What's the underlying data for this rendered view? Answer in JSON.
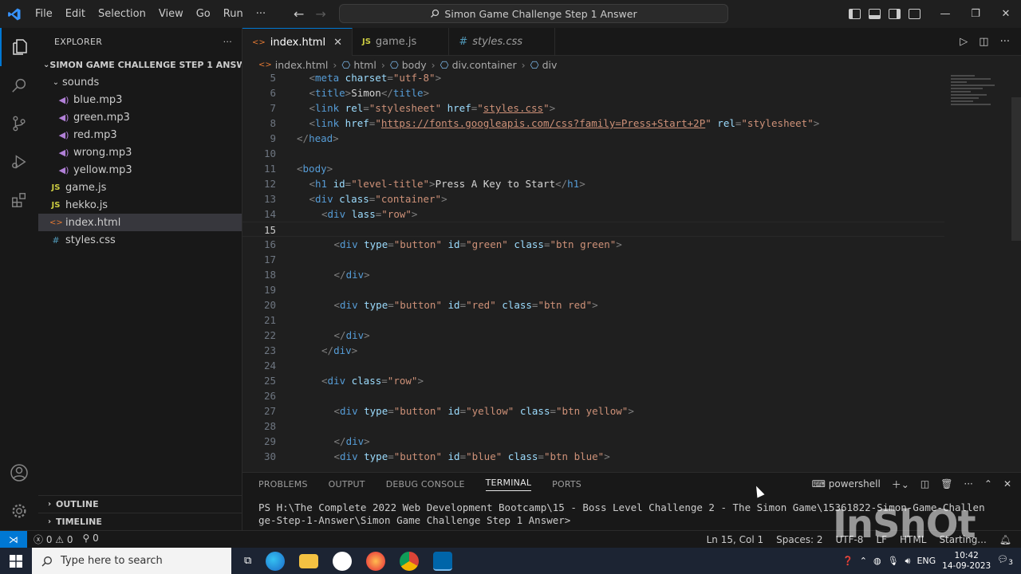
{
  "titlebar": {
    "menu": [
      "File",
      "Edit",
      "Selection",
      "View",
      "Go",
      "Run",
      "···"
    ],
    "command_center": "Simon Game Challenge Step 1 Answer",
    "controls": [
      "—",
      "❐",
      "✕"
    ]
  },
  "explorer": {
    "header": "EXPLORER",
    "more": "···",
    "root": "SIMON GAME CHALLENGE STEP 1 ANSWER",
    "sounds_folder": "sounds",
    "sound_files": [
      "blue.mp3",
      "green.mp3",
      "red.mp3",
      "wrong.mp3",
      "yellow.mp3"
    ],
    "files": [
      {
        "name": "game.js",
        "icon": "JS",
        "type": "js"
      },
      {
        "name": "hekko.js",
        "icon": "JS",
        "type": "js"
      },
      {
        "name": "index.html",
        "icon": "<>",
        "type": "html"
      },
      {
        "name": "styles.css",
        "icon": "#",
        "type": "css"
      }
    ],
    "outline": "OUTLINE",
    "timeline": "TIMELINE"
  },
  "tabs": [
    {
      "label": "index.html",
      "icon": "<>",
      "active": true
    },
    {
      "label": "game.js",
      "icon": "JS",
      "active": false
    },
    {
      "label": "styles.css",
      "icon": "#",
      "active": false
    }
  ],
  "breadcrumb": [
    "index.html",
    "html",
    "body",
    "div.container",
    "div"
  ],
  "code": {
    "current_line": 15,
    "lines": [
      {
        "n": "5",
        "indent": 1,
        "parts": [
          [
            "br",
            "<"
          ],
          [
            "tag",
            "meta"
          ],
          [
            "attr",
            " charset"
          ],
          [
            "br",
            "="
          ],
          [
            "val",
            "\"utf-8\""
          ],
          [
            "br",
            ">"
          ]
        ]
      },
      {
        "n": "6",
        "indent": 1,
        "parts": [
          [
            "br",
            "<"
          ],
          [
            "tag",
            "title"
          ],
          [
            "br",
            ">"
          ],
          [
            "txt",
            "Simon"
          ],
          [
            "br",
            "</"
          ],
          [
            "tag",
            "title"
          ],
          [
            "br",
            ">"
          ]
        ]
      },
      {
        "n": "7",
        "indent": 1,
        "parts": [
          [
            "br",
            "<"
          ],
          [
            "tag",
            "link"
          ],
          [
            "attr",
            " rel"
          ],
          [
            "br",
            "="
          ],
          [
            "val",
            "\"stylesheet\""
          ],
          [
            "attr",
            " href"
          ],
          [
            "br",
            "="
          ],
          [
            "val",
            "\""
          ],
          [
            "link",
            "styles.css"
          ],
          [
            "val",
            "\""
          ],
          [
            "br",
            ">"
          ]
        ]
      },
      {
        "n": "8",
        "indent": 1,
        "parts": [
          [
            "br",
            "<"
          ],
          [
            "tag",
            "link"
          ],
          [
            "attr",
            " href"
          ],
          [
            "br",
            "="
          ],
          [
            "val",
            "\""
          ],
          [
            "link",
            "https://fonts.googleapis.com/css?family=Press+Start+2P"
          ],
          [
            "val",
            "\""
          ],
          [
            "attr",
            " rel"
          ],
          [
            "br",
            "="
          ],
          [
            "val",
            "\"stylesheet\""
          ],
          [
            "br",
            ">"
          ]
        ]
      },
      {
        "n": "9",
        "indent": 0,
        "parts": [
          [
            "br",
            "</"
          ],
          [
            "tag",
            "head"
          ],
          [
            "br",
            ">"
          ]
        ]
      },
      {
        "n": "10",
        "indent": 0,
        "parts": []
      },
      {
        "n": "11",
        "indent": 0,
        "parts": [
          [
            "br",
            "<"
          ],
          [
            "tag",
            "body"
          ],
          [
            "br",
            ">"
          ]
        ]
      },
      {
        "n": "12",
        "indent": 1,
        "parts": [
          [
            "br",
            "<"
          ],
          [
            "tag",
            "h1"
          ],
          [
            "attr",
            " id"
          ],
          [
            "br",
            "="
          ],
          [
            "val",
            "\"level-title\""
          ],
          [
            "br",
            ">"
          ],
          [
            "txt",
            "Press A Key to Start"
          ],
          [
            "br",
            "</"
          ],
          [
            "tag",
            "h1"
          ],
          [
            "br",
            ">"
          ]
        ]
      },
      {
        "n": "13",
        "indent": 1,
        "parts": [
          [
            "br",
            "<"
          ],
          [
            "tag",
            "div"
          ],
          [
            "attr",
            " class"
          ],
          [
            "br",
            "="
          ],
          [
            "val",
            "\"container\""
          ],
          [
            "br",
            ">"
          ]
        ]
      },
      {
        "n": "14",
        "indent": 2,
        "parts": [
          [
            "br",
            "<"
          ],
          [
            "tag",
            "div"
          ],
          [
            "attr",
            " lass"
          ],
          [
            "br",
            "="
          ],
          [
            "val",
            "\"row\""
          ],
          [
            "br",
            ">"
          ]
        ]
      },
      {
        "n": "15",
        "indent": 0,
        "parts": []
      },
      {
        "n": "16",
        "indent": 3,
        "parts": [
          [
            "br",
            "<"
          ],
          [
            "tag",
            "div"
          ],
          [
            "attr",
            " type"
          ],
          [
            "br",
            "="
          ],
          [
            "val",
            "\"button\""
          ],
          [
            "attr",
            " id"
          ],
          [
            "br",
            "="
          ],
          [
            "val",
            "\"green\""
          ],
          [
            "attr",
            " class"
          ],
          [
            "br",
            "="
          ],
          [
            "val",
            "\"btn green\""
          ],
          [
            "br",
            ">"
          ]
        ]
      },
      {
        "n": "17",
        "indent": 0,
        "parts": []
      },
      {
        "n": "18",
        "indent": 3,
        "parts": [
          [
            "br",
            "</"
          ],
          [
            "tag",
            "div"
          ],
          [
            "br",
            ">"
          ]
        ]
      },
      {
        "n": "19",
        "indent": 0,
        "parts": []
      },
      {
        "n": "20",
        "indent": 3,
        "parts": [
          [
            "br",
            "<"
          ],
          [
            "tag",
            "div"
          ],
          [
            "attr",
            " type"
          ],
          [
            "br",
            "="
          ],
          [
            "val",
            "\"button\""
          ],
          [
            "attr",
            " id"
          ],
          [
            "br",
            "="
          ],
          [
            "val",
            "\"red\""
          ],
          [
            "attr",
            " class"
          ],
          [
            "br",
            "="
          ],
          [
            "val",
            "\"btn red\""
          ],
          [
            "br",
            ">"
          ]
        ]
      },
      {
        "n": "21",
        "indent": 0,
        "parts": []
      },
      {
        "n": "22",
        "indent": 3,
        "parts": [
          [
            "br",
            "</"
          ],
          [
            "tag",
            "div"
          ],
          [
            "br",
            ">"
          ]
        ]
      },
      {
        "n": "23",
        "indent": 2,
        "parts": [
          [
            "br",
            "</"
          ],
          [
            "tag",
            "div"
          ],
          [
            "br",
            ">"
          ]
        ]
      },
      {
        "n": "24",
        "indent": 0,
        "parts": []
      },
      {
        "n": "25",
        "indent": 2,
        "parts": [
          [
            "br",
            "<"
          ],
          [
            "tag",
            "div"
          ],
          [
            "attr",
            " class"
          ],
          [
            "br",
            "="
          ],
          [
            "val",
            "\"row\""
          ],
          [
            "br",
            ">"
          ]
        ]
      },
      {
        "n": "26",
        "indent": 0,
        "parts": []
      },
      {
        "n": "27",
        "indent": 3,
        "parts": [
          [
            "br",
            "<"
          ],
          [
            "tag",
            "div"
          ],
          [
            "attr",
            " type"
          ],
          [
            "br",
            "="
          ],
          [
            "val",
            "\"button\""
          ],
          [
            "attr",
            " id"
          ],
          [
            "br",
            "="
          ],
          [
            "val",
            "\"yellow\""
          ],
          [
            "attr",
            " class"
          ],
          [
            "br",
            "="
          ],
          [
            "val",
            "\"btn yellow\""
          ],
          [
            "br",
            ">"
          ]
        ]
      },
      {
        "n": "28",
        "indent": 0,
        "parts": []
      },
      {
        "n": "29",
        "indent": 3,
        "parts": [
          [
            "br",
            "</"
          ],
          [
            "tag",
            "div"
          ],
          [
            "br",
            ">"
          ]
        ]
      },
      {
        "n": "30",
        "indent": 3,
        "parts": [
          [
            "br",
            "<"
          ],
          [
            "tag",
            "div"
          ],
          [
            "attr",
            " type"
          ],
          [
            "br",
            "="
          ],
          [
            "val",
            "\"button\""
          ],
          [
            "attr",
            " id"
          ],
          [
            "br",
            "="
          ],
          [
            "val",
            "\"blue\""
          ],
          [
            "attr",
            " class"
          ],
          [
            "br",
            "="
          ],
          [
            "val",
            "\"btn blue\""
          ],
          [
            "br",
            ">"
          ]
        ]
      }
    ]
  },
  "panel": {
    "tabs": [
      "PROBLEMS",
      "OUTPUT",
      "DEBUG CONSOLE",
      "TERMINAL",
      "PORTS"
    ],
    "active_tab": "TERMINAL",
    "shell": "powershell",
    "terminal_lines": [
      "PS H:\\The Complete 2022 Web Development Bootcamp\\15 - Boss Level Challenge 2 - The Simon Game\\15361822-Simon-Game-Challen",
      "ge-Step-1-Answer\\Simon Game Challenge Step 1 Answer>"
    ]
  },
  "statusbar": {
    "errors": "0",
    "warnings": "0",
    "ports": "0",
    "position": "Ln 15, Col 1",
    "spaces": "Spaces: 2",
    "encoding": "UTF-8",
    "eol": "LF",
    "language": "HTML",
    "activity": "Starting..."
  },
  "taskbar": {
    "search_placeholder": "Type here to search",
    "lang": "ENG",
    "time": "10:42",
    "date": "14-09-2023",
    "notifications": "3"
  },
  "watermark": "InShOt",
  "colors": {
    "accent": "#0078d4",
    "editor_bg": "#1f1f1f",
    "sidebar_bg": "#181818"
  }
}
